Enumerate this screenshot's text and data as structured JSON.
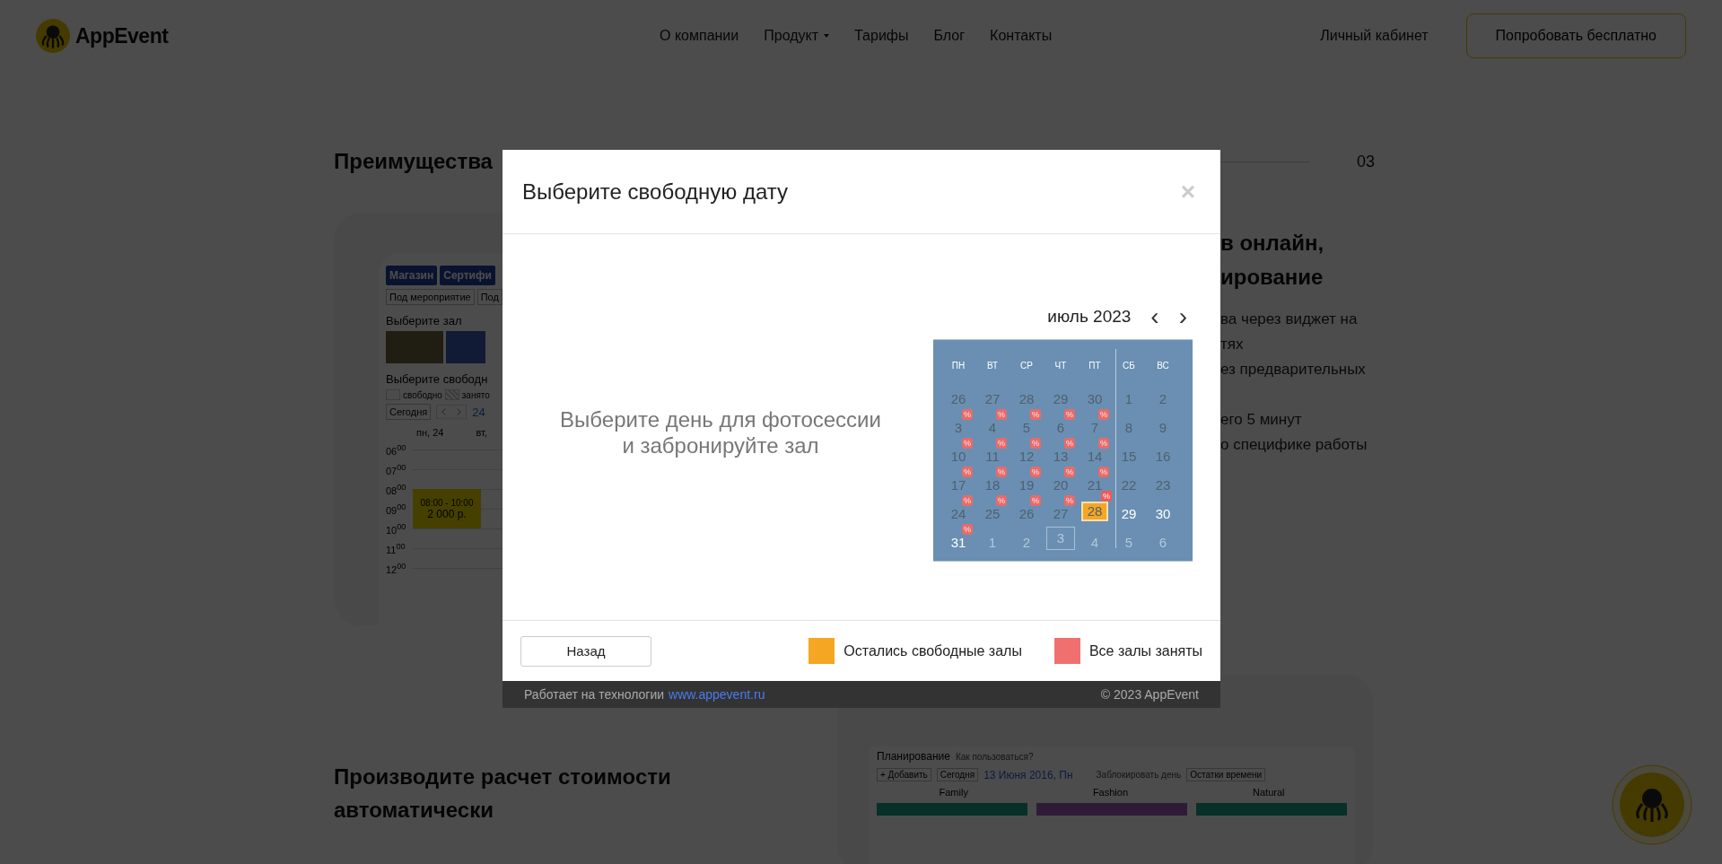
{
  "header": {
    "logo": "AppEvent",
    "nav": [
      {
        "label": "О компании",
        "dropdown": false
      },
      {
        "label": "Продукт",
        "dropdown": true
      },
      {
        "label": "Тарифы",
        "dropdown": false
      },
      {
        "label": "Блог",
        "dropdown": false
      },
      {
        "label": "Контакты",
        "dropdown": false
      }
    ],
    "account": "Личный кабинет",
    "cta": "Попробовать бесплатно"
  },
  "section": {
    "title": "Преимущества",
    "number": "03",
    "mock": {
      "buttons": [
        "Магазин",
        "Сертифи"
      ],
      "tabs": [
        "Под мероприятие",
        "Под"
      ],
      "hall_title": "Выберите зал",
      "date_title": "Выберите свободн",
      "legend": [
        "свободно",
        "занято"
      ],
      "today": "Сегодня",
      "date": "24",
      "days": [
        "пн, 24",
        "вт,"
      ],
      "times": [
        "06$^{00}$",
        "07$^{00}$",
        "08$^{00}$",
        "09$^{00}$",
        "10$^{00}$",
        "11$^{00}$",
        "12$^{00}$"
      ],
      "event_time": "08:00 - 10:00",
      "event_price": "2 000 р."
    },
    "heading_lines": [
      "в онлайн,",
      "ирование"
    ],
    "text_paragraphs": [
      [
        "ва через виджет на",
        "тях",
        "ез предварительных"
      ],
      [
        "его 5 минут",
        "о специфике работы"
      ]
    ]
  },
  "section2": {
    "title_lines": [
      "Производите расчет стоимости",
      "автоматически"
    ],
    "mock": {
      "title": "Планирование",
      "help": "Как пользоваться?",
      "add": "+ Добавить",
      "today": "Сегодня",
      "date": "13 Июня 2016, Пн",
      "block": "Заблокировать день",
      "remain": "Остатки времени",
      "halls": [
        "Family",
        "Fashion",
        "Natural"
      ]
    }
  },
  "modal": {
    "title": "Выберите свободную дату",
    "close": "×",
    "prompt_lines": [
      "Выберите день для фотосессии",
      "и забронируйте зал"
    ],
    "calendar": {
      "month": "июль 2023",
      "prev": "‹",
      "next": "›",
      "weekdays": [
        "ПН",
        "ВТ",
        "СР",
        "ЧТ",
        "ПТ",
        "СБ",
        "ВС"
      ],
      "days": [
        {
          "d": "26",
          "kind": "past",
          "selected": false,
          "today": false
        },
        {
          "d": "27",
          "kind": "past",
          "selected": false,
          "today": false
        },
        {
          "d": "28",
          "kind": "past",
          "selected": false,
          "today": false
        },
        {
          "d": "29",
          "kind": "past",
          "selected": false,
          "today": false
        },
        {
          "d": "30",
          "kind": "past",
          "selected": false,
          "today": false
        },
        {
          "d": "1",
          "kind": "past",
          "selected": false,
          "today": false
        },
        {
          "d": "2",
          "kind": "past",
          "selected": false,
          "today": false
        },
        {
          "d": "3",
          "kind": "past",
          "badge": "%",
          "selected": false,
          "today": false
        },
        {
          "d": "4",
          "kind": "past",
          "badge": "%",
          "selected": false,
          "today": false
        },
        {
          "d": "5",
          "kind": "past",
          "badge": "%",
          "selected": false,
          "today": false
        },
        {
          "d": "6",
          "kind": "past",
          "badge": "%",
          "selected": false,
          "today": false
        },
        {
          "d": "7",
          "kind": "past",
          "badge": "%",
          "selected": false,
          "today": false
        },
        {
          "d": "8",
          "kind": "past",
          "selected": false,
          "today": false
        },
        {
          "d": "9",
          "kind": "past",
          "selected": false,
          "today": false
        },
        {
          "d": "10",
          "kind": "past",
          "badge": "%",
          "selected": false,
          "today": false
        },
        {
          "d": "11",
          "kind": "past",
          "badge": "%",
          "selected": false,
          "today": false
        },
        {
          "d": "12",
          "kind": "past",
          "badge": "%",
          "selected": false,
          "today": false
        },
        {
          "d": "13",
          "kind": "past",
          "badge": "%",
          "selected": false,
          "today": false
        },
        {
          "d": "14",
          "kind": "past",
          "badge": "%",
          "selected": false,
          "today": false
        },
        {
          "d": "15",
          "kind": "past",
          "selected": false,
          "today": false
        },
        {
          "d": "16",
          "kind": "past",
          "selected": false,
          "today": false
        },
        {
          "d": "17",
          "kind": "past",
          "badge": "%",
          "selected": false,
          "today": false
        },
        {
          "d": "18",
          "kind": "past",
          "badge": "%",
          "selected": false,
          "today": false
        },
        {
          "d": "19",
          "kind": "past",
          "badge": "%",
          "selected": false,
          "today": false
        },
        {
          "d": "20",
          "kind": "past",
          "badge": "%",
          "selected": false,
          "today": false
        },
        {
          "d": "21",
          "kind": "past",
          "badge": "%",
          "selected": false,
          "today": false
        },
        {
          "d": "22",
          "kind": "past",
          "selected": false,
          "today": false
        },
        {
          "d": "23",
          "kind": "past",
          "selected": false,
          "today": false
        },
        {
          "d": "24",
          "kind": "past",
          "badge": "%",
          "selected": false,
          "today": false
        },
        {
          "d": "25",
          "kind": "past",
          "badge": "%",
          "selected": false,
          "today": false
        },
        {
          "d": "26",
          "kind": "past",
          "badge": "%",
          "selected": false,
          "today": false
        },
        {
          "d": "27",
          "kind": "past",
          "badge": "%",
          "selected": false,
          "today": false
        },
        {
          "d": "28",
          "kind": "free",
          "badge": "%",
          "selected": true,
          "today": false
        },
        {
          "d": "29",
          "kind": "free",
          "selected": false,
          "today": false
        },
        {
          "d": "30",
          "kind": "free",
          "selected": false,
          "today": false
        },
        {
          "d": "31",
          "kind": "free",
          "badge": "%",
          "selected": false,
          "today": false
        },
        {
          "d": "1",
          "kind": "outside",
          "selected": false,
          "today": false
        },
        {
          "d": "2",
          "kind": "outside",
          "selected": false,
          "today": false
        },
        {
          "d": "3",
          "kind": "outside",
          "selected": false,
          "today": true
        },
        {
          "d": "4",
          "kind": "outside",
          "selected": false,
          "today": false
        },
        {
          "d": "5",
          "kind": "outside",
          "selected": false,
          "today": false
        },
        {
          "d": "6",
          "kind": "outside",
          "selected": false,
          "today": false
        }
      ]
    },
    "back": "Назад",
    "legend": [
      {
        "label": "Остались свободные залы",
        "color": "#f5a623"
      },
      {
        "label": "Все залы заняты",
        "color": "#f07070"
      }
    ],
    "footer": {
      "text": "Работает на технологии",
      "link": "www.appevent.ru",
      "copyright": "© 2023 AppEvent"
    }
  }
}
